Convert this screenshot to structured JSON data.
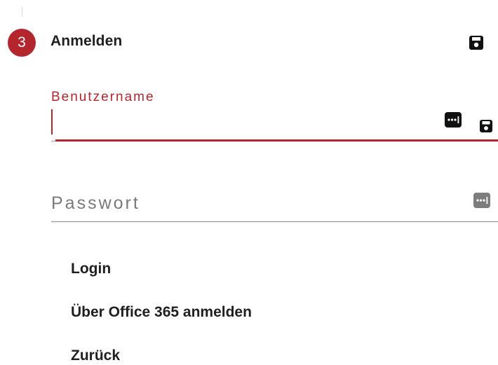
{
  "step": {
    "number": "3",
    "title": "Anmelden",
    "save_icon": "save-icon",
    "accent_color": "#b3262e"
  },
  "username": {
    "label": "Benutzername",
    "value": "",
    "password_manager_icon": "password-manager-icon",
    "save_icon": "save-icon"
  },
  "password": {
    "placeholder": "Passwort",
    "value": "",
    "password_manager_icon": "password-manager-icon"
  },
  "actions": {
    "login": "Login",
    "office365": "Über Office 365 anmelden",
    "back": "Zurück"
  }
}
